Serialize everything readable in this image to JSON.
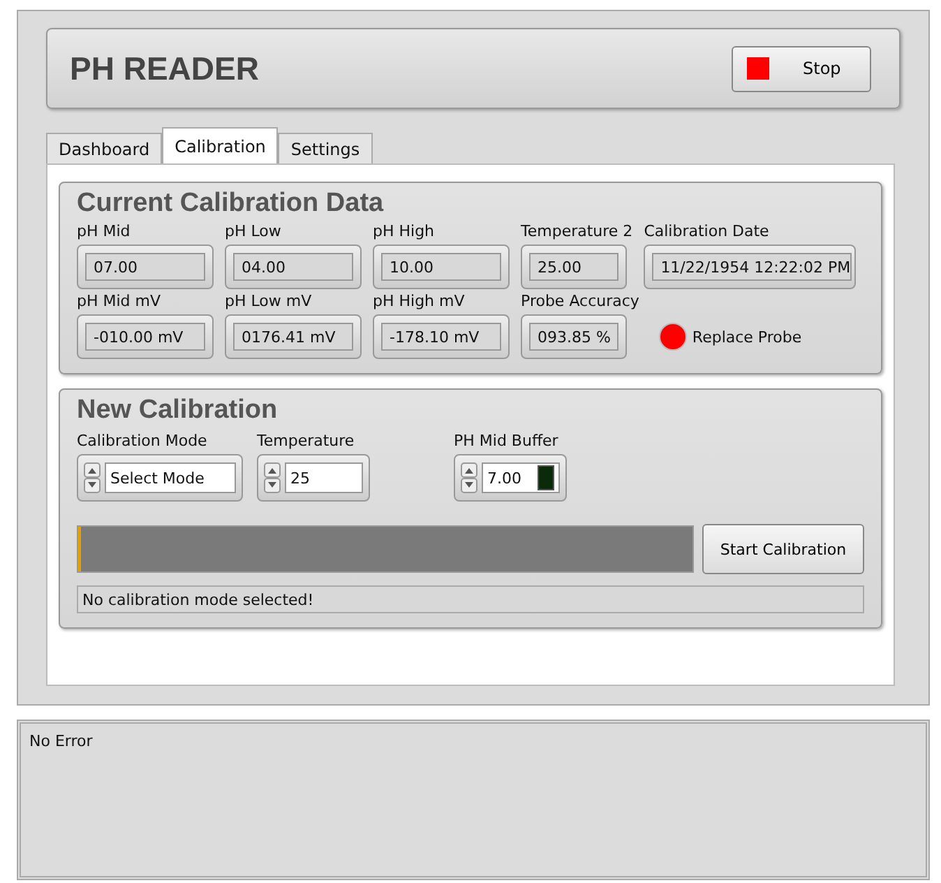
{
  "title": "PH READER",
  "stop_button": {
    "label": "Stop",
    "on": true
  },
  "tabs": [
    {
      "label": "Dashboard",
      "selected": false
    },
    {
      "label": "Calibration",
      "selected": true
    },
    {
      "label": "Settings",
      "selected": false
    }
  ],
  "current_calibration": {
    "title": "Current Calibration Data",
    "rows": [
      [
        {
          "label": "pH Mid",
          "value": "07.00"
        },
        {
          "label": "pH Low",
          "value": "04.00"
        },
        {
          "label": "pH High",
          "value": "10.00"
        },
        {
          "label": "Temperature 2",
          "value": "25.00"
        },
        {
          "label": "Calibration Date",
          "value": "11/22/1954 12:22:02 PM"
        }
      ],
      [
        {
          "label": "pH Mid mV",
          "value": "-010.00 mV"
        },
        {
          "label": "pH Low mV",
          "value": "0176.41 mV"
        },
        {
          "label": "pH High mV",
          "value": "-178.10 mV"
        },
        {
          "label": "Probe Accuracy",
          "value": "093.85 %"
        }
      ]
    ],
    "indicator": {
      "label": "Replace Probe",
      "on": true
    }
  },
  "new_calibration": {
    "title": "New Calibration",
    "controls": [
      {
        "label": "Calibration Mode",
        "value": "Select Mode"
      },
      {
        "label": "Temperature",
        "value": "25"
      },
      {
        "label": "PH Mid Buffer",
        "value": "7.00",
        "led_on": false
      }
    ],
    "progress": {
      "level": 0.005
    },
    "start_button": "Start Calibration",
    "status": "No calibration mode selected!"
  },
  "error_panel": {
    "text": "No Error"
  }
}
